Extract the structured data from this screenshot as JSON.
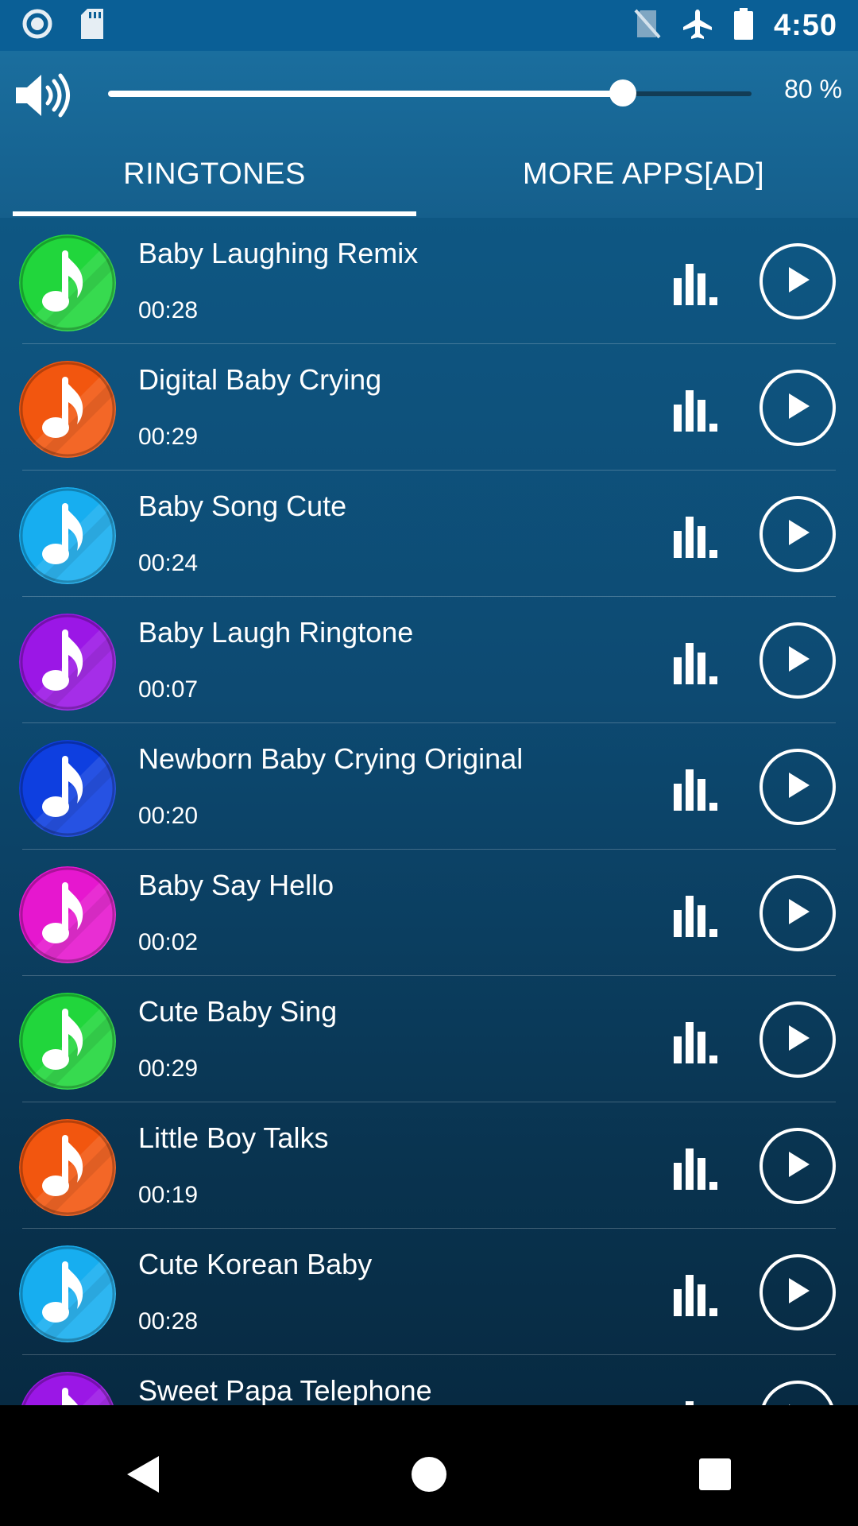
{
  "status_bar": {
    "time": "4:50",
    "left_icons": [
      "record-icon",
      "sd-card-icon"
    ],
    "right_icons": [
      "no-sim-icon",
      "airplane-mode-icon",
      "battery-icon"
    ]
  },
  "volume": {
    "icon": "speaker-icon",
    "level": 0.8,
    "percent_label": "80 %"
  },
  "tabs": [
    {
      "label": "RINGTONES",
      "active": true
    },
    {
      "label": "MORE APPS[AD]",
      "active": false
    }
  ],
  "ringtones": [
    {
      "title": "Baby Laughing Remix",
      "duration": "00:28",
      "color": "#21d63c"
    },
    {
      "title": "Digital Baby Crying",
      "duration": "00:29",
      "color": "#f2560f"
    },
    {
      "title": "Baby Song Cute",
      "duration": "00:24",
      "color": "#17aef0"
    },
    {
      "title": "Baby Laugh Ringtone",
      "duration": "00:07",
      "color": "#9b17e6"
    },
    {
      "title": "Newborn Baby Crying Original",
      "duration": "00:20",
      "color": "#0e3fe0"
    },
    {
      "title": "Baby Say Hello",
      "duration": "00:02",
      "color": "#e617cf"
    },
    {
      "title": "Cute Baby Sing",
      "duration": "00:29",
      "color": "#21d63c"
    },
    {
      "title": "Little Boy Talks",
      "duration": "00:19",
      "color": "#f2560f"
    },
    {
      "title": "Cute Korean Baby",
      "duration": "00:28",
      "color": "#17aef0"
    },
    {
      "title": "Sweet Papa Telephone",
      "duration": "",
      "color": "#9b17e6"
    }
  ],
  "nav": [
    {
      "icon": "back-icon"
    },
    {
      "icon": "home-icon"
    },
    {
      "icon": "recents-icon"
    }
  ]
}
